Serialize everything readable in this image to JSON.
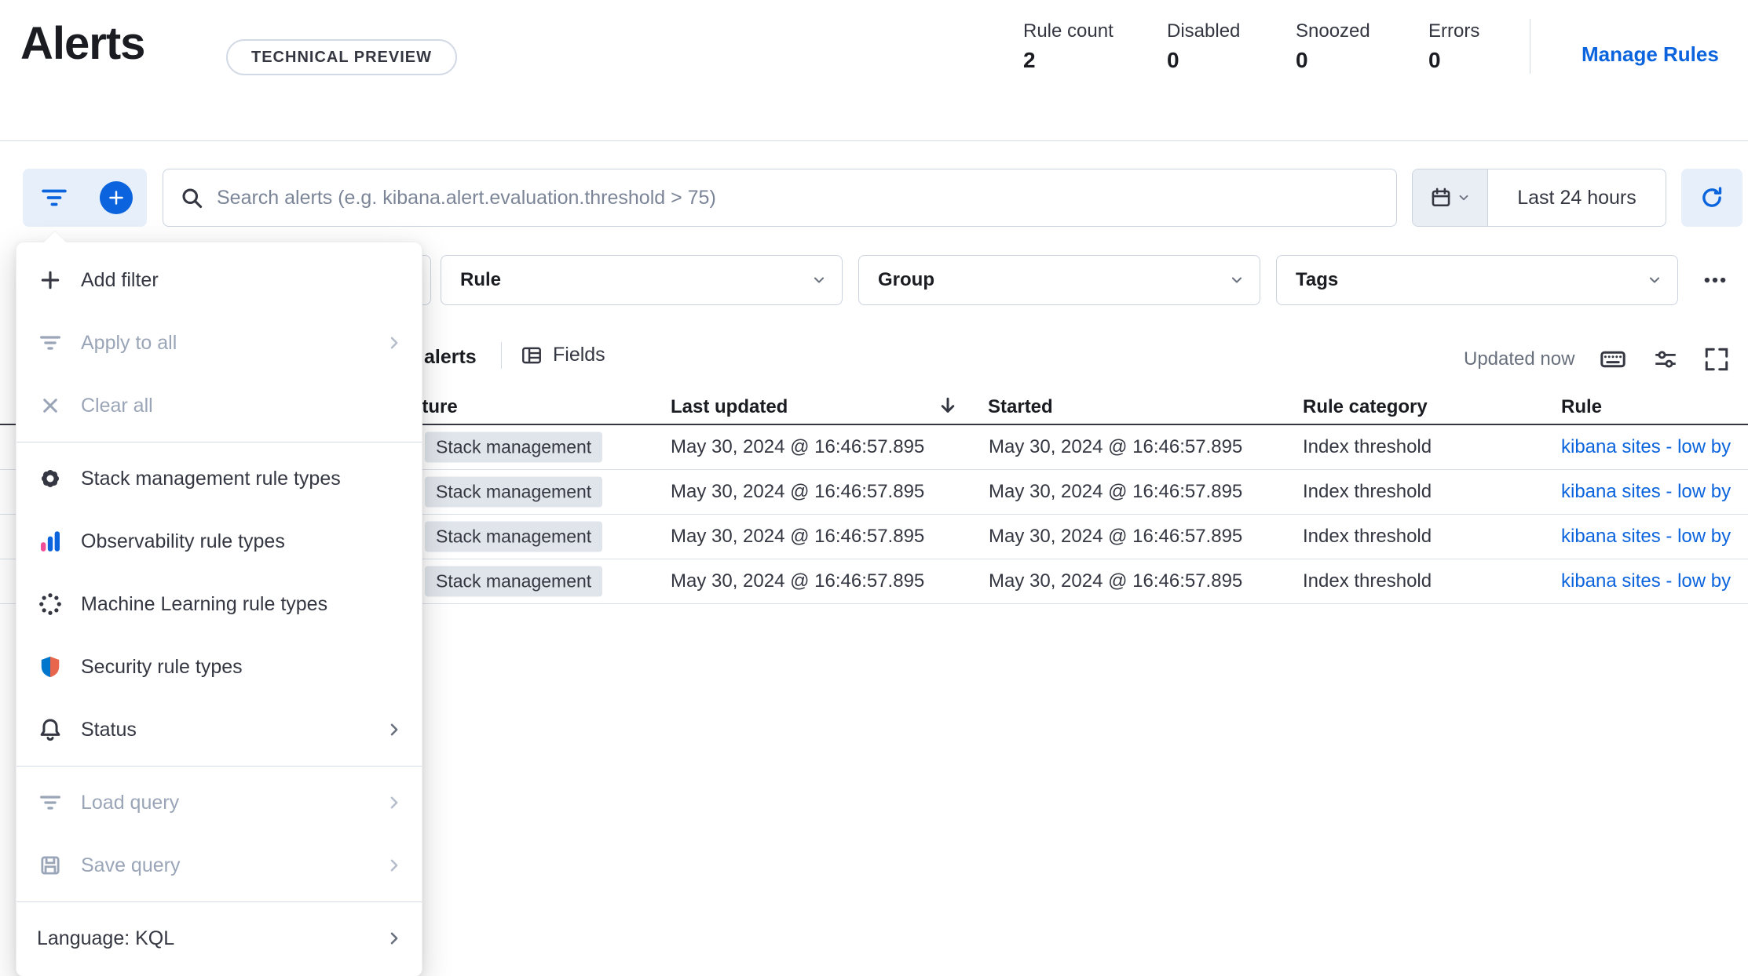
{
  "header": {
    "title": "Alerts",
    "badge": "TECHNICAL PREVIEW",
    "stats": [
      {
        "label": "Rule count",
        "value": "2"
      },
      {
        "label": "Disabled",
        "value": "0"
      },
      {
        "label": "Snoozed",
        "value": "0"
      },
      {
        "label": "Errors",
        "value": "0"
      }
    ],
    "manage_rules_label": "Manage Rules"
  },
  "toolbar": {
    "search_placeholder": "Search alerts (e.g. kibana.alert.evaluation.threshold > 75)",
    "time_range_label": "Last 24 hours"
  },
  "filter_bar": {
    "filters": [
      {
        "label": "Rule"
      },
      {
        "label": "Group"
      },
      {
        "label": "Tags"
      }
    ]
  },
  "filter_menu": {
    "items": [
      {
        "label": "Add filter",
        "icon": "plus-icon",
        "disabled": false,
        "submenu": false
      },
      {
        "label": "Apply to all",
        "icon": "filter-icon",
        "disabled": true,
        "submenu": true
      },
      {
        "label": "Clear all",
        "icon": "cross-icon",
        "disabled": true,
        "submenu": false
      },
      {
        "label": "Stack management rule types",
        "icon": "gear-icon",
        "disabled": false,
        "submenu": false
      },
      {
        "label": "Observability rule types",
        "icon": "observability-logo-icon",
        "disabled": false,
        "submenu": false
      },
      {
        "label": "Machine Learning rule types",
        "icon": "machine-learning-logo-icon",
        "disabled": false,
        "submenu": false
      },
      {
        "label": "Security rule types",
        "icon": "security-logo-icon",
        "disabled": false,
        "submenu": false
      },
      {
        "label": "Status",
        "icon": "bell-icon",
        "disabled": false,
        "submenu": true
      },
      {
        "label": "Load query",
        "icon": "filter-icon",
        "disabled": true,
        "submenu": true
      },
      {
        "label": "Save query",
        "icon": "save-icon",
        "disabled": true,
        "submenu": true
      },
      {
        "label": "Language: KQL",
        "icon": null,
        "disabled": false,
        "submenu": true
      }
    ]
  },
  "table_toolbar": {
    "alerts_label": "alerts",
    "fields_label": "Fields",
    "updated_label": "Updated now"
  },
  "table": {
    "columns": {
      "feature": "Feature",
      "last_updated": "Last updated",
      "started": "Started",
      "rule_category": "Rule category",
      "rule": "Rule"
    },
    "rows": [
      {
        "feature": "Stack management",
        "last_updated": "May 30, 2024 @ 16:46:57.895",
        "started": "May 30, 2024 @ 16:46:57.895",
        "rule_category": "Index threshold",
        "rule": "kibana sites - low by"
      },
      {
        "feature": "Stack management",
        "last_updated": "May 30, 2024 @ 16:46:57.895",
        "started": "May 30, 2024 @ 16:46:57.895",
        "rule_category": "Index threshold",
        "rule": "kibana sites - low by"
      },
      {
        "feature": "Stack management",
        "last_updated": "May 30, 2024 @ 16:46:57.895",
        "started": "May 30, 2024 @ 16:46:57.895",
        "rule_category": "Index threshold",
        "rule": "kibana sites - low by"
      },
      {
        "feature": "Stack management",
        "last_updated": "May 30, 2024 @ 16:46:57.895",
        "started": "May 30, 2024 @ 16:46:57.895",
        "rule_category": "Index threshold",
        "rule": "kibana sites - low by"
      }
    ]
  },
  "colors": {
    "primary_blue": "#0B64DD",
    "light_blue_button_bg": "#E6EFFA",
    "badge_bg": "#E0E5EB",
    "border": "#D3DAE6",
    "disabled_text": "#9AA5B8"
  }
}
